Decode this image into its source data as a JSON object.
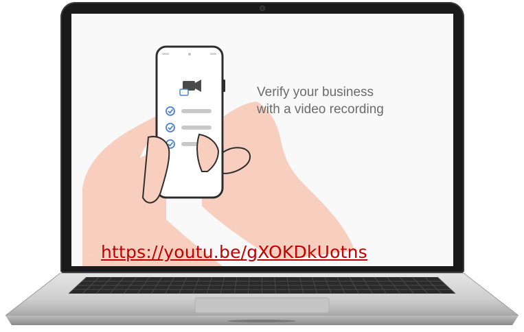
{
  "video": {
    "headline_line1": "Verify your business",
    "headline_line2": "with a video recording"
  },
  "link": {
    "text": "https://youtu.be/gXOKDkUotns"
  },
  "icons": [
    "video-camera-icon",
    "check-circle-icon"
  ],
  "colors": {
    "link": "#c10000",
    "skin": "#f9cfc0",
    "check": "#4a7fd4",
    "headline": "#6a6a6a"
  }
}
